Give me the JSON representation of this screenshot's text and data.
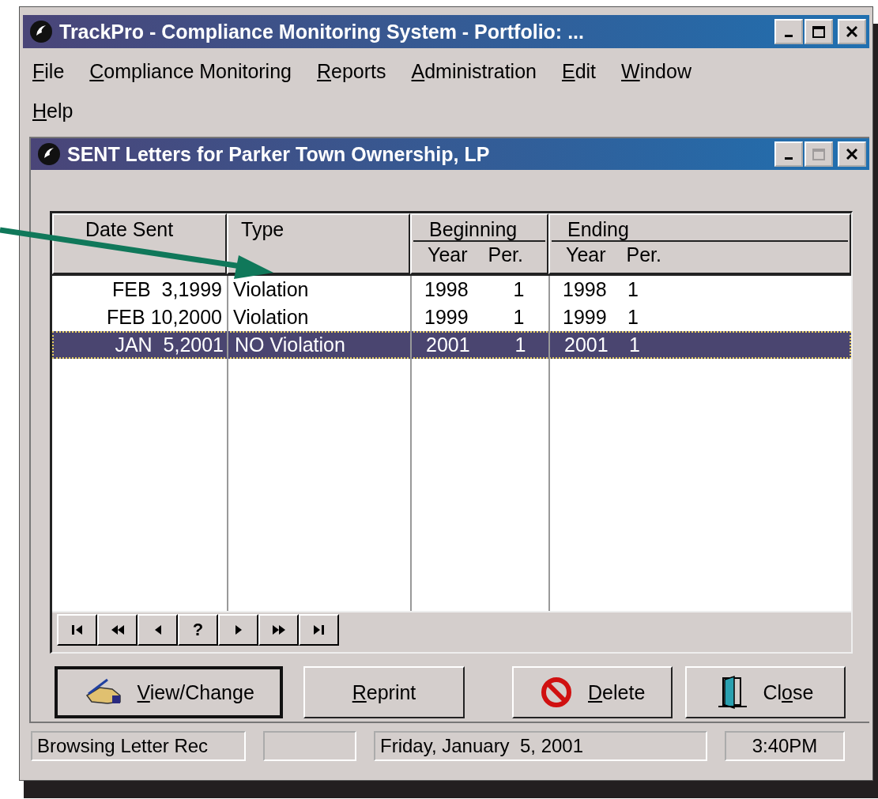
{
  "window": {
    "title": "TrackPro - Compliance Monitoring System - Portfolio: ..."
  },
  "menu": [
    {
      "key": "F",
      "rest": "ile"
    },
    {
      "key": "C",
      "rest": "ompliance Monitoring"
    },
    {
      "key": "R",
      "rest": "eports"
    },
    {
      "key": "A",
      "rest": "dministration"
    },
    {
      "key": "E",
      "rest": "dit"
    },
    {
      "key": "W",
      "rest": "indow"
    },
    {
      "key": "H",
      "rest": "elp"
    }
  ],
  "child_window": {
    "title": "SENT Letters for Parker Town Ownership, LP",
    "maximize_disabled": true
  },
  "table": {
    "columns": [
      {
        "label": "Date Sent"
      },
      {
        "label": "Type"
      },
      {
        "label": "Beginning",
        "sub": [
          "Year",
          "Per."
        ]
      },
      {
        "label": "Ending",
        "sub": [
          "Year",
          "Per."
        ]
      }
    ],
    "rows": [
      {
        "date": "FEB  3,1999",
        "type": "Violation",
        "begin_year": "1998",
        "begin_per": "1",
        "end_year": "1998",
        "end_per": "1",
        "selected": false
      },
      {
        "date": "FEB 10,2000",
        "type": "Violation",
        "begin_year": "1999",
        "begin_per": "1",
        "end_year": "1999",
        "end_per": "1",
        "selected": false
      },
      {
        "date": "JAN  5,2001",
        "type": "NO Violation",
        "begin_year": "2001",
        "begin_per": "1",
        "end_year": "2001",
        "end_per": "1",
        "selected": true
      }
    ]
  },
  "navigator": [
    {
      "kind": "first"
    },
    {
      "kind": "prev-page"
    },
    {
      "kind": "prev"
    },
    {
      "kind": "find",
      "label": "?"
    },
    {
      "kind": "next"
    },
    {
      "kind": "next-page"
    },
    {
      "kind": "last"
    }
  ],
  "buttons": [
    {
      "kind": "edit",
      "key": "V",
      "rest": "iew/Change",
      "default": true
    },
    {
      "kind": "plain",
      "key": "R",
      "rest": "eprint",
      "default": false
    },
    {
      "kind": "delete",
      "key": "D",
      "rest": "elete",
      "default": false
    },
    {
      "kind": "close",
      "before": "Cl",
      "key": "o",
      "rest": "se",
      "default": false
    }
  ],
  "status_bar": [
    {
      "kind": "text",
      "text": "Browsing Letter Rec"
    },
    {
      "kind": "blank"
    },
    {
      "kind": "text",
      "text": "Friday, January  5, 2001"
    },
    {
      "kind": "text",
      "text": "3:40PM"
    }
  ]
}
